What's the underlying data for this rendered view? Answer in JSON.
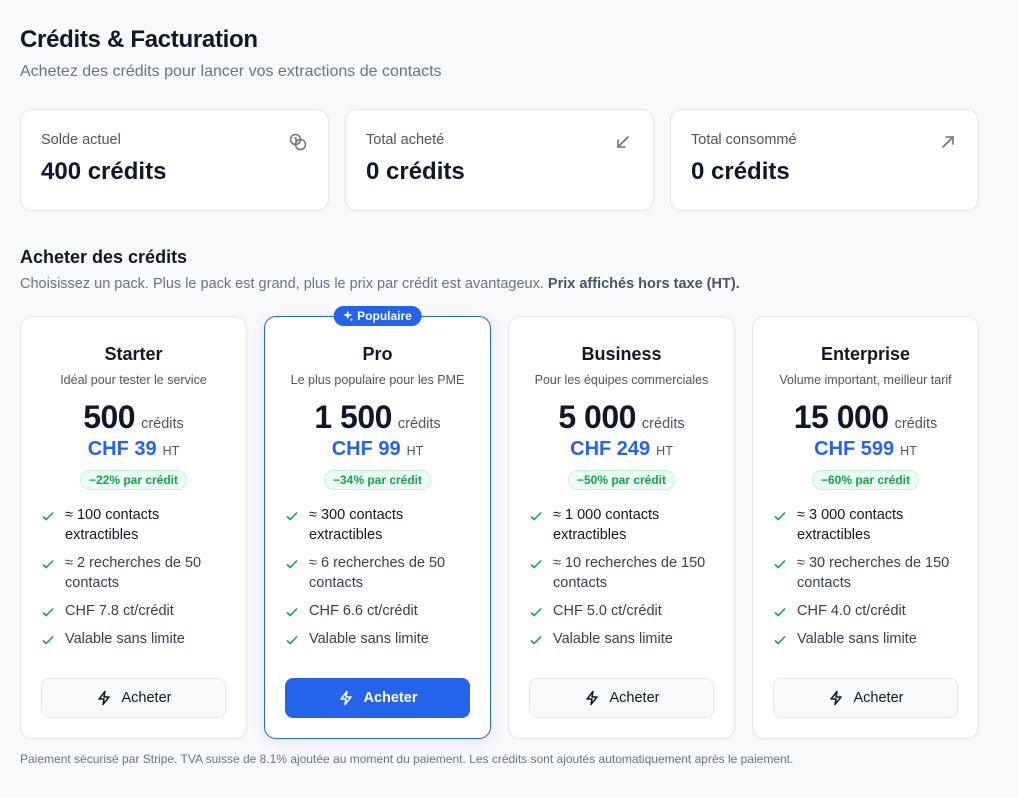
{
  "header": {
    "title": "Crédits & Facturation",
    "subtitle": "Achetez des crédits pour lancer vos extractions de contacts"
  },
  "stats": [
    {
      "label": "Solde actuel",
      "value": "400 crédits",
      "icon": "coins-icon"
    },
    {
      "label": "Total acheté",
      "value": "0 crédits",
      "icon": "arrow-down-left-icon"
    },
    {
      "label": "Total consommé",
      "value": "0 crédits",
      "icon": "arrow-up-right-icon"
    }
  ],
  "buy_section": {
    "title": "Acheter des crédits",
    "description": "Choisissez un pack. Plus le pack est grand, plus le prix par crédit est avantageux.",
    "description_bold": "Prix affichés hors taxe (HT)."
  },
  "plans": [
    {
      "name": "Starter",
      "description": "Idéal pour tester le service",
      "credits": "500",
      "credits_unit": "crédits",
      "price": "CHF 39",
      "price_suffix": "HT",
      "discount": "−22% par crédit",
      "features": [
        "≈ 100 contacts extractibles",
        "≈ 2 recherches de 50 contacts",
        "CHF 7.8 ct/crédit",
        "Valable sans limite"
      ],
      "button": "Acheter"
    },
    {
      "name": "Pro",
      "badge": "Populaire",
      "description": "Le plus populaire pour les PME",
      "credits": "1 500",
      "credits_unit": "crédits",
      "price": "CHF 99",
      "price_suffix": "HT",
      "discount": "−34% par crédit",
      "features": [
        "≈ 300 contacts extractibles",
        "≈ 6 recherches de 50 contacts",
        "CHF 6.6 ct/crédit",
        "Valable sans limite"
      ],
      "button": "Acheter"
    },
    {
      "name": "Business",
      "description": "Pour les équipes commerciales",
      "credits": "5 000",
      "credits_unit": "crédits",
      "price": "CHF 249",
      "price_suffix": "HT",
      "discount": "−50% par crédit",
      "features": [
        "≈ 1 000 contacts extractibles",
        "≈ 10 recherches de 150 contacts",
        "CHF 5.0 ct/crédit",
        "Valable sans limite"
      ],
      "button": "Acheter"
    },
    {
      "name": "Enterprise",
      "description": "Volume important, meilleur tarif",
      "credits": "15 000",
      "credits_unit": "crédits",
      "price": "CHF 599",
      "price_suffix": "HT",
      "discount": "−60% par crédit",
      "features": [
        "≈ 3 000 contacts extractibles",
        "≈ 30 recherches de 150 contacts",
        "CHF 4.0 ct/crédit",
        "Valable sans limite"
      ],
      "button": "Acheter"
    }
  ],
  "footer": "Paiement sécurisé par Stripe. TVA suisse de 8.1% ajoutée au moment du paiement. Les crédits sont ajoutés automatiquement après le paiement.",
  "colors": {
    "accent": "#2563eb",
    "success": "#16a34a",
    "success_bg": "#ecfdf3"
  }
}
